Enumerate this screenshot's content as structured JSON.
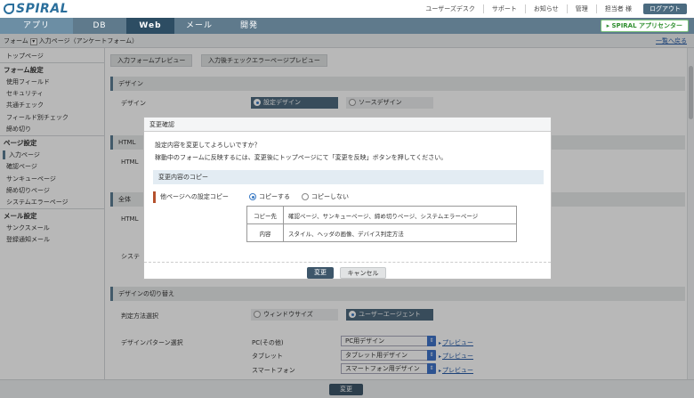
{
  "header": {
    "logo_text": "SPIRAL",
    "links": [
      "ユーザーズデスク",
      "サポート",
      "お知らせ",
      "管理",
      "担当者 様"
    ],
    "logout_label": "ログアウト"
  },
  "nav": {
    "tabs": [
      "アプリ",
      "DB",
      "Web",
      "メール",
      "開発"
    ],
    "active_tab": "Web",
    "spiral_app_label": "SPIRAL アプリセンター"
  },
  "breadcrumb": {
    "root": "フォーム",
    "current": "入力ページ（アンケートフォーム）",
    "back_link": "一覧へ戻る"
  },
  "sidebar": {
    "top": "トップページ",
    "form_settings_head": "フォーム設定",
    "form_items": [
      "使用フィールド",
      "セキュリティ",
      "共通チェック",
      "フィールド別チェック",
      "締め切り"
    ],
    "page_settings_head": "ページ設定",
    "page_items": [
      "入力ページ",
      "確認ページ",
      "サンキューページ",
      "締め切りページ",
      "システムエラーページ"
    ],
    "mail_settings_head": "メール設定",
    "mail_items": [
      "サンクスメール",
      "登録通知メール"
    ]
  },
  "main": {
    "preview_tabs": [
      "入力フォームプレビュー",
      "入力後チェックエラーページプレビュー"
    ],
    "design_section": "デザイン",
    "design_label": "デザイン",
    "design_option_setting": "設定デザイン",
    "design_option_source": "ソースデザイン",
    "html_section_prefix": "HTML",
    "html_label": "HTML",
    "all_section": "全体",
    "all_html_label": "HTML",
    "system_label": "システ",
    "switch_section": "デザインの切り替え",
    "judge_label": "判定方法選択",
    "judge_window": "ウィンドウサイズ",
    "judge_agent": "ユーザーエージェント",
    "pattern_label": "デザインパターン選択",
    "devices": [
      {
        "name": "PC(その他)",
        "select": "PC用デザイン",
        "preview": "プレビュー"
      },
      {
        "name": "タブレット",
        "select": "タブレット用デザイン",
        "preview": "プレビュー"
      },
      {
        "name": "スマートフォン",
        "select": "スマートフォン用デザイン",
        "preview": "プレビュー"
      }
    ],
    "change_button": "変更"
  },
  "modal": {
    "title": "変更確認",
    "text1": "設定内容を変更してよろしいですか？",
    "text2": "稼動中のフォームに反映するには、変更後にトップページにて「変更を反映」ボタンを押してください。",
    "copy_section": "変更内容のコピー",
    "copy_label": "他ページへの設定コピー",
    "copy_yes": "コピーする",
    "copy_no": "コピーしない",
    "rows": [
      {
        "head": "コピー先",
        "value": "確認ページ、サンキューページ、締め切りページ、システムエラーページ"
      },
      {
        "head": "内容",
        "value": "スタイル、ヘッダの画像、デバイス判定方法"
      }
    ],
    "confirm_button": "変更",
    "cancel_button": "キャンセル"
  }
}
